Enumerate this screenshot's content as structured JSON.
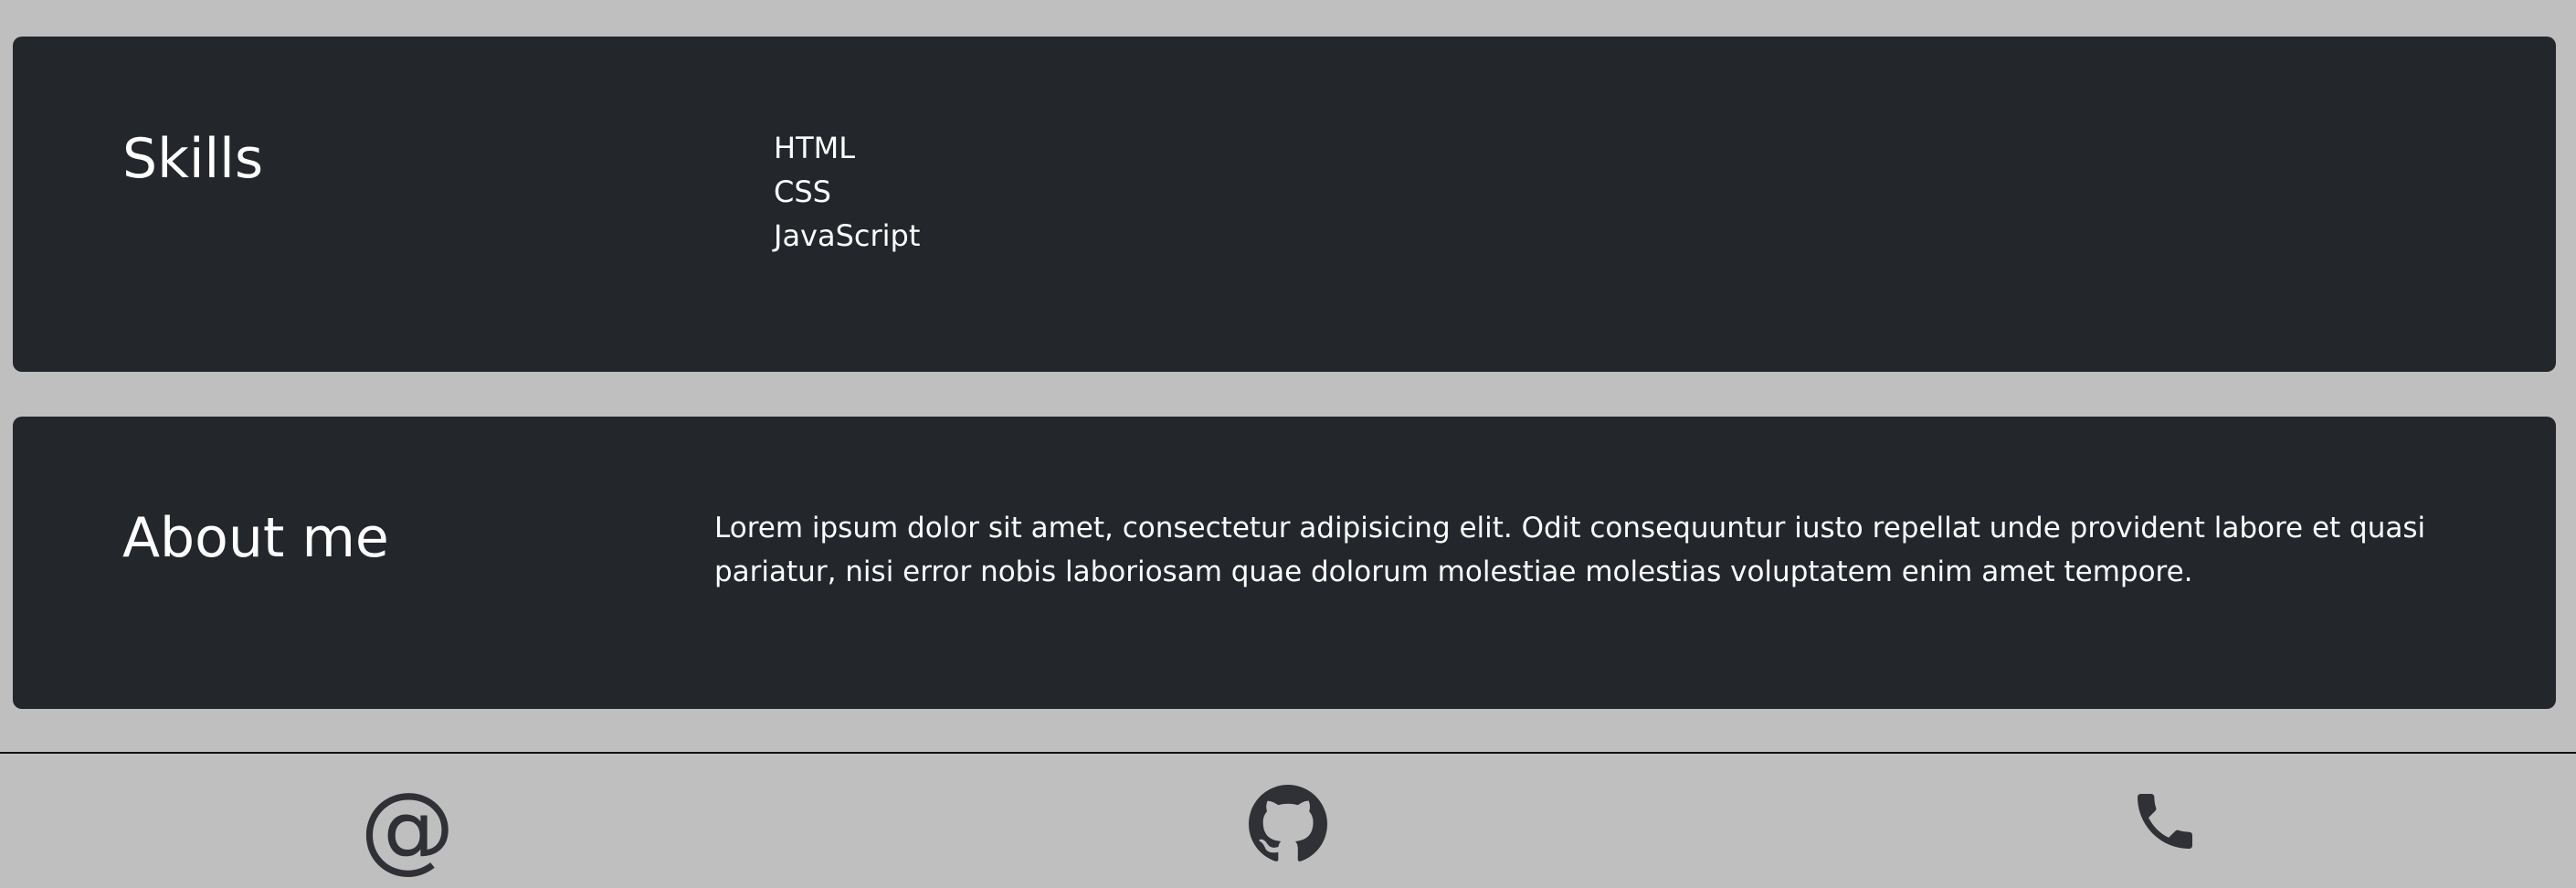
{
  "skills": {
    "heading": "Skills",
    "items": [
      "HTML",
      "CSS",
      "JavaScript"
    ]
  },
  "about": {
    "heading": "About me",
    "text": "Lorem ipsum dolor sit amet, consectetur adipisicing elit. Odit consequuntur iusto repellat unde provident labore et quasi pariatur, nisi error nobis laboriosam quae dolorum molestiae molestias voluptatem enim amet tempore."
  },
  "footer": {
    "icons": [
      {
        "name": "at-icon",
        "glyph": "@"
      },
      {
        "name": "github-icon"
      },
      {
        "name": "phone-icon"
      }
    ]
  },
  "colors": {
    "background": "#bfbfbf",
    "card": "#23262b",
    "text": "#ffffff",
    "icon": "#2f3136"
  }
}
